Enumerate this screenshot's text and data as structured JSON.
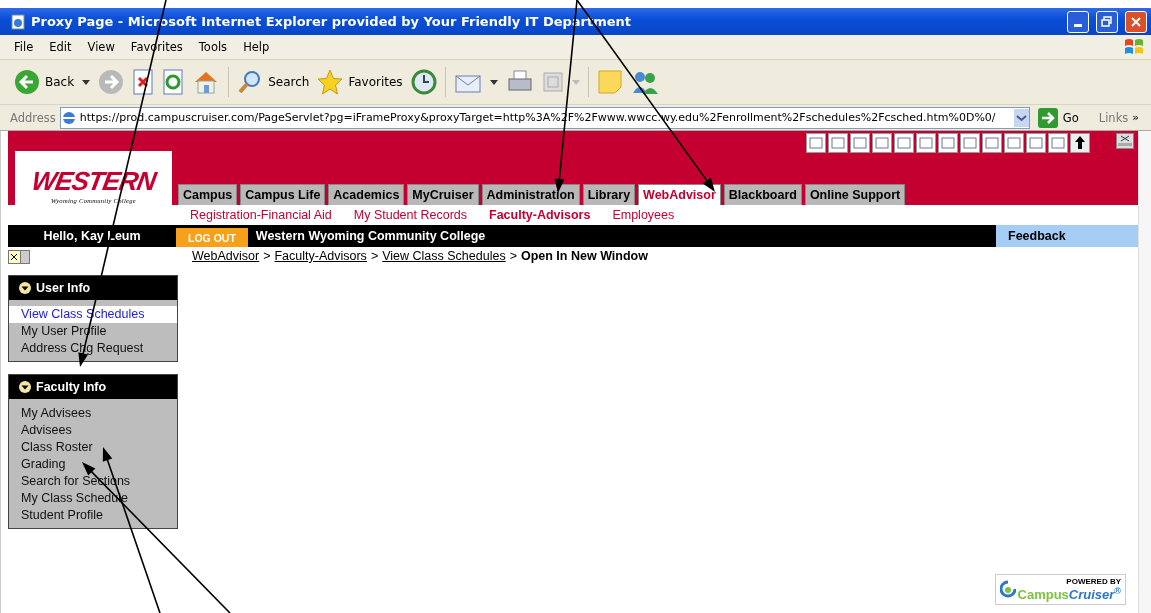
{
  "window": {
    "title": "Proxy Page - Microsoft Internet Explorer provided by Your Friendly IT Department"
  },
  "menu": [
    "File",
    "Edit",
    "View",
    "Favorites",
    "Tools",
    "Help"
  ],
  "toolbar": {
    "back": "Back",
    "search": "Search",
    "favorites": "Favorites"
  },
  "address": {
    "label": "Address",
    "value": "https://prod.campuscruiser.com/PageServlet?pg=iFrameProxy&proxyTarget=http%3A%2F%2Fwww.wwcc.wy.edu%2Fenrollment%2Fschedules%2Fcsched.htm%0D%0/",
    "go": "Go",
    "links": "Links",
    "more": "»"
  },
  "logo": {
    "title": "WESTERN",
    "subtitle": "Wyoming Community College"
  },
  "tabs": [
    {
      "label": "Campus",
      "selected": false
    },
    {
      "label": "Campus Life",
      "selected": false
    },
    {
      "label": "Academics",
      "selected": false
    },
    {
      "label": "MyCruiser",
      "selected": false
    },
    {
      "label": "Administration",
      "selected": false
    },
    {
      "label": "Library",
      "selected": false
    },
    {
      "label": "WebAdvisor",
      "selected": true
    },
    {
      "label": "Blackboard",
      "selected": false
    },
    {
      "label": "Online Support",
      "selected": false
    }
  ],
  "subtabs": [
    {
      "label": "Registration-Financial Aid",
      "selected": false
    },
    {
      "label": "My Student Records",
      "selected": false
    },
    {
      "label": "Faculty-Advisors",
      "selected": true
    },
    {
      "label": "Employees",
      "selected": false
    }
  ],
  "user_bar": {
    "greeting": "Hello, Kay Leum",
    "logout": "LOG OUT",
    "college": "Western Wyoming Community College",
    "feedback": "Feedback"
  },
  "breadcrumb": {
    "links": [
      "WebAdvisor",
      "Faculty-Advisors",
      "View Class Schedules"
    ],
    "separator": ">",
    "current": "Open In New Window"
  },
  "sidebar": [
    {
      "title": "User Info",
      "items": [
        {
          "label": "View Class Schedules",
          "selected": true
        },
        {
          "label": "My User Profile",
          "selected": false
        },
        {
          "label": "Address Chg Request",
          "selected": false
        }
      ]
    },
    {
      "title": "Faculty Info",
      "items": [
        {
          "label": "My Advisees",
          "selected": false
        },
        {
          "label": "Advisees",
          "selected": false
        },
        {
          "label": "Class Roster",
          "selected": false
        },
        {
          "label": "Grading",
          "selected": false
        },
        {
          "label": "Search for Sections",
          "selected": false
        },
        {
          "label": "My Class Schedule",
          "selected": false
        },
        {
          "label": "Student Profile",
          "selected": false
        }
      ]
    }
  ],
  "powered": {
    "caption": "POWERED BY",
    "brand_1": "Campus",
    "brand_2": "Cruiser",
    "mark": "®"
  }
}
